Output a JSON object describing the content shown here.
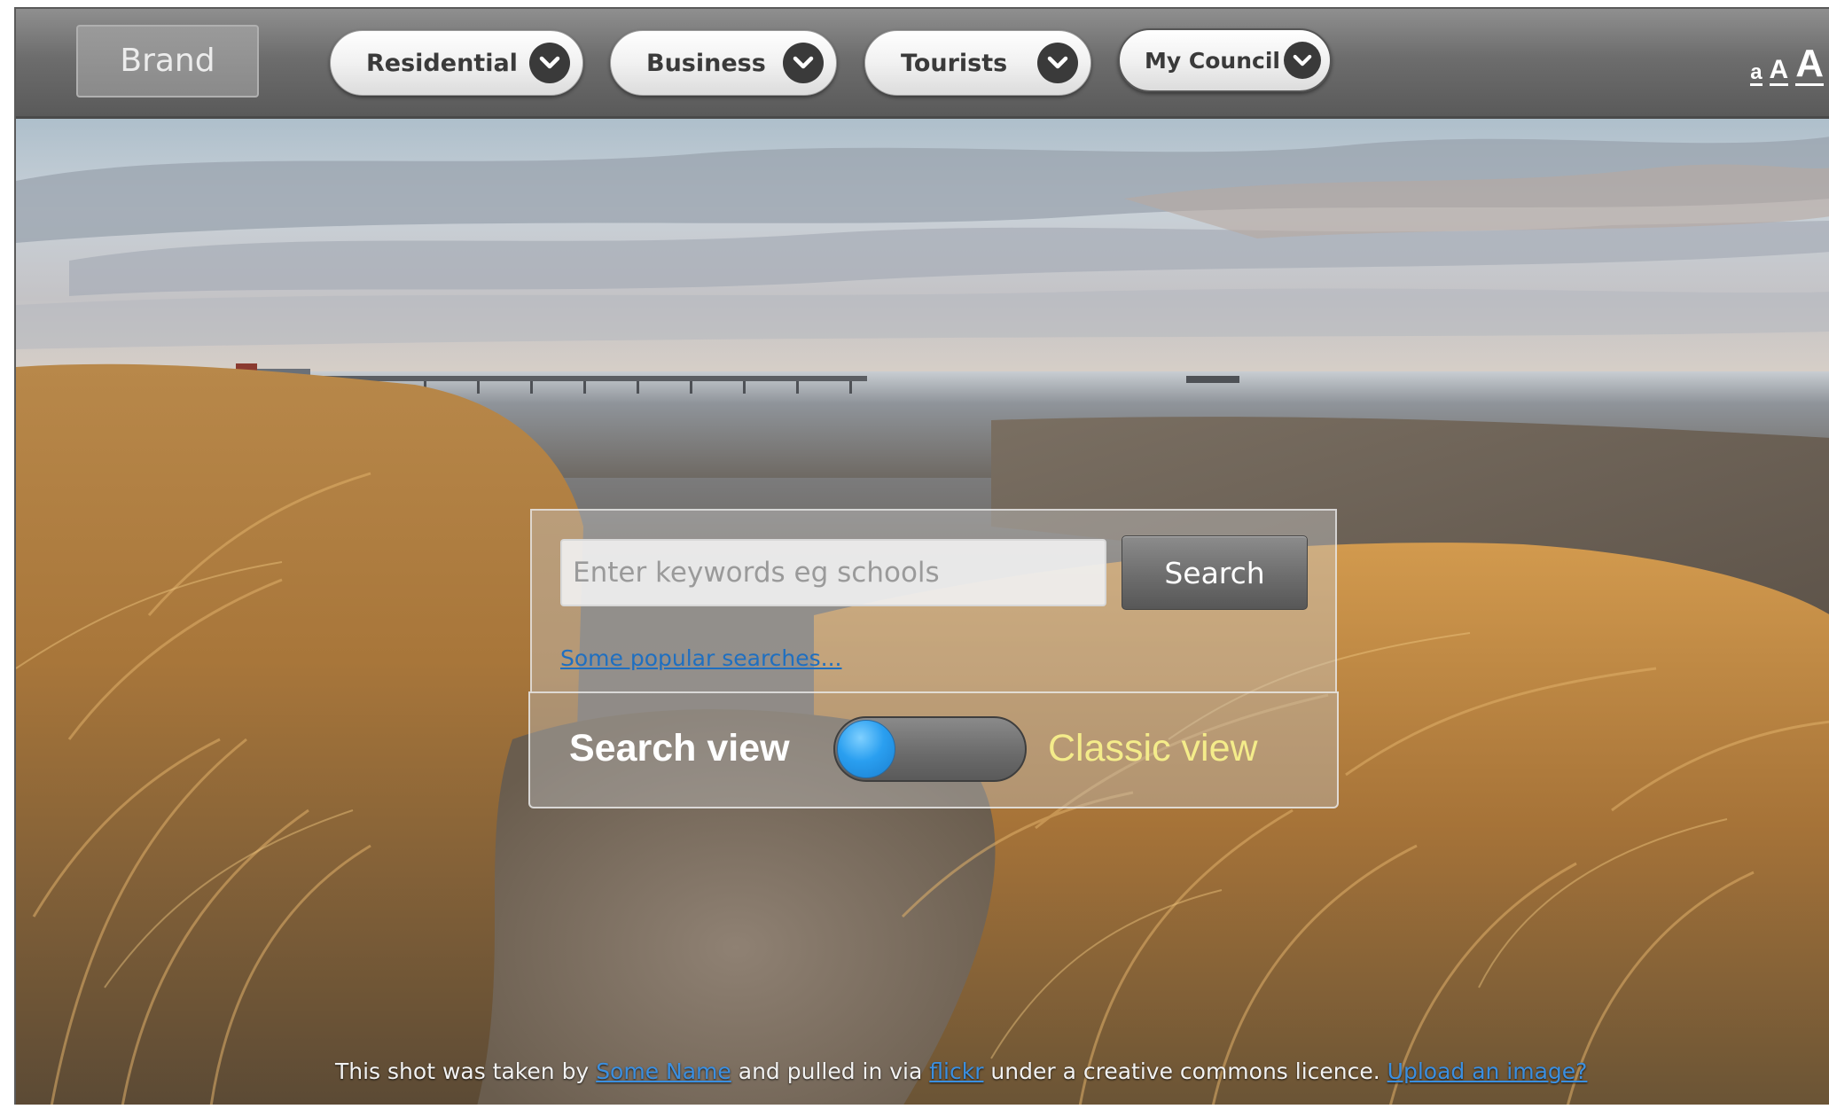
{
  "nav": {
    "brand": "Brand",
    "items": [
      {
        "label": "Residential"
      },
      {
        "label": "Business"
      },
      {
        "label": "Tourists"
      },
      {
        "label": "My Council"
      }
    ],
    "font_sizer": {
      "small": "a",
      "medium": "A",
      "large": "A"
    }
  },
  "search": {
    "placeholder": "Enter keywords eg schools",
    "value": "",
    "button_label": "Search",
    "popular_link": "Some popular searches..."
  },
  "view_switch": {
    "left_label": "Search view",
    "right_label": "Classic view",
    "selected": "Search view"
  },
  "credits": {
    "prefix": "This shot was taken by ",
    "author_link": "Some Name",
    "middle": " and pulled in via ",
    "source_link": "flickr",
    "suffix": " under a creative commons licence. ",
    "upload_link": "Upload an image?"
  },
  "colors": {
    "navbar": "#6d6d6d",
    "link": "#1f6fc0",
    "toggle_knob": "#2a9ff0",
    "classic_label": "#f4ec8a"
  },
  "icons": {
    "nav_dropdown": "chevron-down-icon"
  }
}
